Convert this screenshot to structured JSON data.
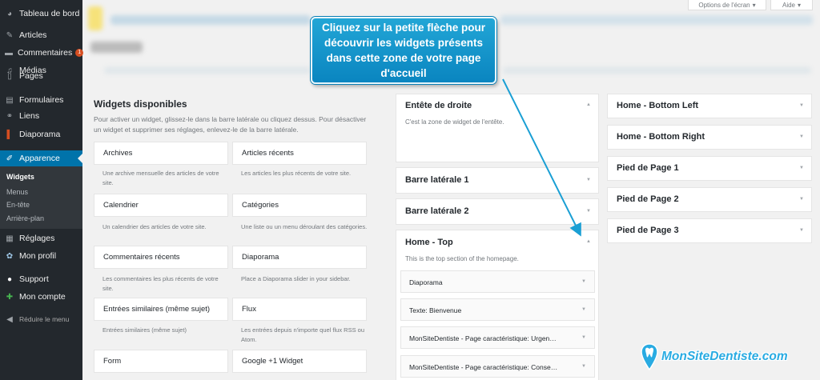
{
  "sidebar": {
    "items": [
      {
        "label": "Tableau de bord",
        "icon": "dashboard-icon"
      },
      {
        "label": "Articles",
        "icon": "pin-icon"
      },
      {
        "label": "Commentaires",
        "icon": "comment-icon",
        "badge": "1"
      },
      {
        "label": "Médias",
        "icon": "media-icon"
      },
      {
        "label": "Pages",
        "icon": "page-icon"
      },
      {
        "label": "Formulaires",
        "icon": "form-icon"
      },
      {
        "label": "Liens",
        "icon": "link-icon"
      },
      {
        "label": "Diaporama",
        "icon": "slideshow-icon"
      },
      {
        "label": "Apparence",
        "icon": "brush-icon"
      },
      {
        "label": "Réglages",
        "icon": "settings-icon"
      },
      {
        "label": "Mon profil",
        "icon": "profile-icon"
      },
      {
        "label": "Support",
        "icon": "support-icon"
      },
      {
        "label": "Mon compte",
        "icon": "plus-icon"
      },
      {
        "label": "Réduire le menu",
        "icon": "collapse-icon"
      }
    ],
    "submenu": [
      "Widgets",
      "Menus",
      "En-tête",
      "Arrière-plan"
    ]
  },
  "screen_options": {
    "options_label": "Options de l'écran",
    "help_label": "Aide"
  },
  "available": {
    "title": "Widgets disponibles",
    "description": "Pour activer un widget, glissez-le dans la barre latérale ou cliquez dessus. Pour désactiver un widget et supprimer ses réglages, enlevez-le de la barre latérale.",
    "widgets": [
      {
        "name": "Archives",
        "desc": "Une archive mensuelle des articles de votre site."
      },
      {
        "name": "Articles récents",
        "desc": "Les articles les plus récents de votre site."
      },
      {
        "name": "Calendrier",
        "desc": "Un calendrier des articles de votre site."
      },
      {
        "name": "Catégories",
        "desc": "Une liste ou un menu déroulant des catégories."
      },
      {
        "name": "Commentaires récents",
        "desc": "Les commentaires les plus récents de votre site."
      },
      {
        "name": "Diaporama",
        "desc": "Place a Diaporama slider in your sidebar."
      },
      {
        "name": "Entrées similaires (même sujet)",
        "desc": "Entrées similaires (même sujet)"
      },
      {
        "name": "Flux",
        "desc": "Les entrées depuis n'importe quel flux RSS ou Atom."
      },
      {
        "name": "Form",
        "desc": ""
      },
      {
        "name": "Google +1 Widget",
        "desc": ""
      }
    ]
  },
  "areas": {
    "header_right": {
      "title": "Entête de droite",
      "desc": "C'est la zone de widget de l'entête."
    },
    "sidebar1": {
      "title": "Barre latérale 1"
    },
    "sidebar2": {
      "title": "Barre latérale 2"
    },
    "home_top": {
      "title": "Home - Top",
      "desc": "This is the top section of the homepage.",
      "widgets": [
        {
          "type": "Diaporama",
          "title": ""
        },
        {
          "type": "Texte",
          "title": ": Bienvenue"
        },
        {
          "type": "MonSiteDentiste - Page caractéristique",
          "title": ": Urgen…"
        },
        {
          "type": "MonSiteDentiste - Page caractéristique",
          "title": ": Conse…"
        }
      ]
    },
    "right": [
      "Home - Bottom Left",
      "Home - Bottom Right",
      "Pied de Page 1",
      "Pied de Page 2",
      "Pied de Page 3"
    ]
  },
  "callout": {
    "text": "Cliquez sur la petite flèche pour découvrir les widgets présents dans cette zone de votre page d'accueil"
  },
  "watermark": {
    "text": "MonSiteDentiste.com"
  },
  "colors": {
    "sidebar_bg": "#23282d",
    "accent": "#0073aa",
    "callout": "#1a9fd4",
    "badge": "#d54e21"
  }
}
